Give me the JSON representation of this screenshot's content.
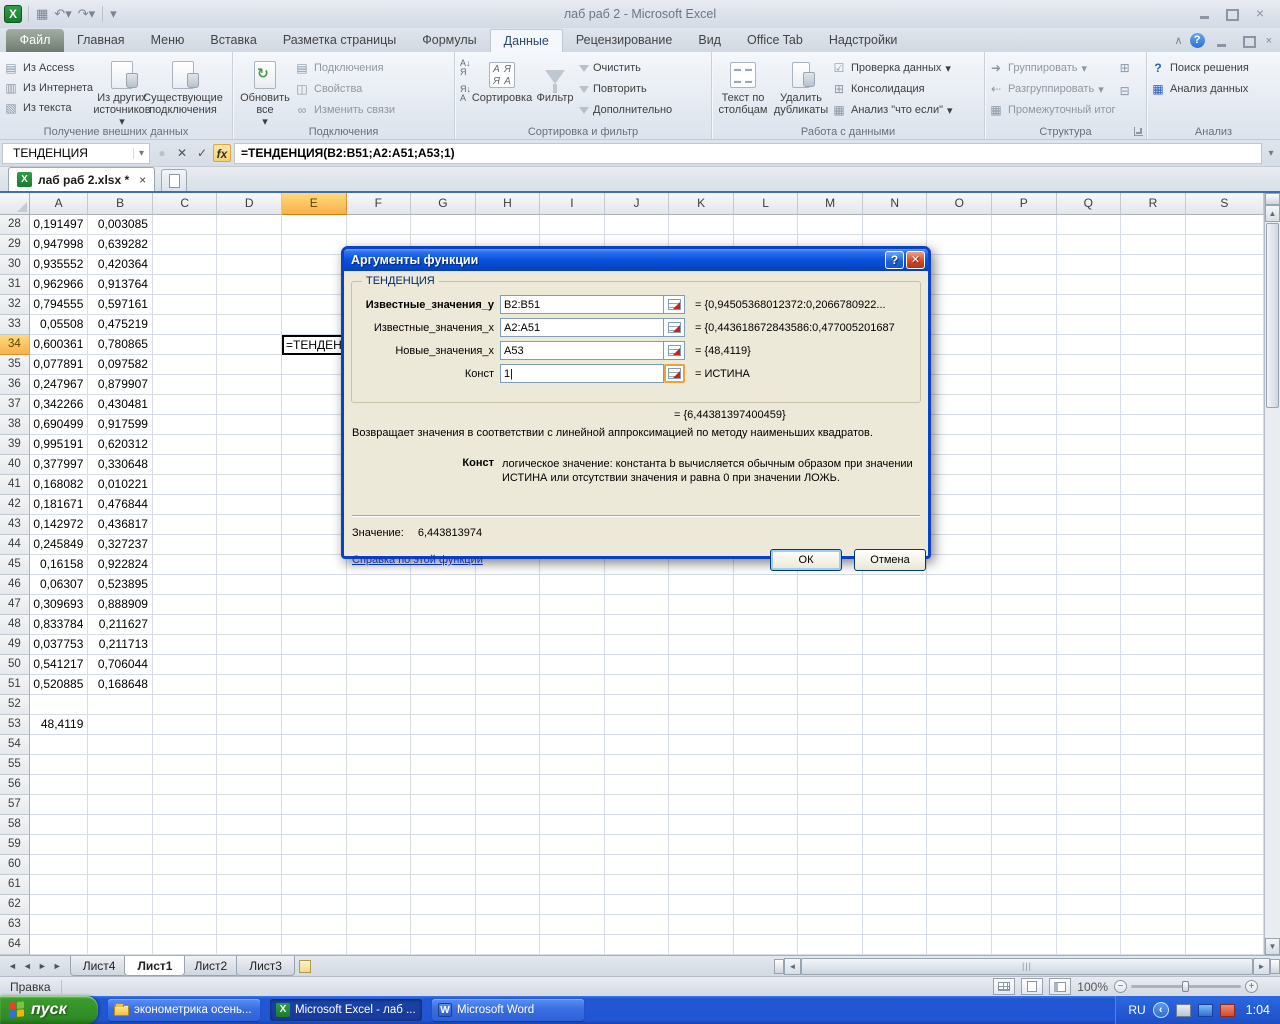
{
  "window": {
    "title": "лаб раб 2  -  Microsoft Excel"
  },
  "ribbon": {
    "file_tab": "Файл",
    "tabs": [
      {
        "label": "Главная",
        "active": false
      },
      {
        "label": "Меню",
        "active": false
      },
      {
        "label": "Вставка",
        "active": false
      },
      {
        "label": "Разметка страницы",
        "active": false
      },
      {
        "label": "Формулы",
        "active": false
      },
      {
        "label": "Данные",
        "active": true
      },
      {
        "label": "Рецензирование",
        "active": false
      },
      {
        "label": "Вид",
        "active": false
      },
      {
        "label": "Office Tab",
        "active": false
      },
      {
        "label": "Надстройки",
        "active": false
      }
    ],
    "groups": [
      {
        "label": "Получение внешних данных",
        "items": [
          "Из Access",
          "Из Интернета",
          "Из текста",
          "Из других источников",
          "Существующие подключения"
        ]
      },
      {
        "label": "Подключения",
        "items": [
          "Обновить все",
          "Подключения",
          "Свойства",
          "Изменить связи"
        ]
      },
      {
        "label": "Сортировка и фильтр",
        "items": [
          "Сортировка",
          "Фильтр",
          "Очистить",
          "Повторить",
          "Дополнительно"
        ]
      },
      {
        "label": "Работа с данными",
        "items": [
          "Текст по столбцам",
          "Удалить дубликаты",
          "Проверка данных",
          "Консолидация",
          "Анализ \"что если\""
        ]
      },
      {
        "label": "Структура",
        "items": [
          "Группировать",
          "Разгруппировать",
          "Промежуточный итог"
        ]
      },
      {
        "label": "Анализ",
        "items": [
          "Поиск решения",
          "Анализ данных"
        ]
      }
    ]
  },
  "formula_bar": {
    "name_box": "ТЕНДЕНЦИЯ",
    "fx_label": "fx",
    "formula": "=ТЕНДЕНЦИЯ(B2:B51;A2:A51;A53;1)"
  },
  "doc_tabs": {
    "active_tab": "лаб раб 2.xlsx *"
  },
  "grid": {
    "columns": [
      "A",
      "B",
      "C",
      "D",
      "E",
      "F",
      "G",
      "H",
      "I",
      "J",
      "K",
      "L",
      "M",
      "N",
      "O",
      "P",
      "Q",
      "R",
      "S"
    ],
    "selected_column": "E",
    "selected_row": 34,
    "first_row": 28,
    "last_row": 64,
    "editing": {
      "cell": "E34",
      "text": "=ТЕНДЕН"
    },
    "rows": [
      {
        "n": 28,
        "a": "0,191497",
        "b": "0,003085"
      },
      {
        "n": 29,
        "a": "0,947998",
        "b": "0,639282"
      },
      {
        "n": 30,
        "a": "0,935552",
        "b": "0,420364"
      },
      {
        "n": 31,
        "a": "0,962966",
        "b": "0,913764"
      },
      {
        "n": 32,
        "a": "0,794555",
        "b": "0,597161"
      },
      {
        "n": 33,
        "a": "0,05508",
        "b": "0,475219"
      },
      {
        "n": 34,
        "a": "0,600361",
        "b": "0,780865"
      },
      {
        "n": 35,
        "a": "0,077891",
        "b": "0,097582"
      },
      {
        "n": 36,
        "a": "0,247967",
        "b": "0,879907"
      },
      {
        "n": 37,
        "a": "0,342266",
        "b": "0,430481"
      },
      {
        "n": 38,
        "a": "0,690499",
        "b": "0,917599"
      },
      {
        "n": 39,
        "a": "0,995191",
        "b": "0,620312"
      },
      {
        "n": 40,
        "a": "0,377997",
        "b": "0,330648"
      },
      {
        "n": 41,
        "a": "0,168082",
        "b": "0,010221"
      },
      {
        "n": 42,
        "a": "0,181671",
        "b": "0,476844"
      },
      {
        "n": 43,
        "a": "0,142972",
        "b": "0,436817"
      },
      {
        "n": 44,
        "a": "0,245849",
        "b": "0,327237"
      },
      {
        "n": 45,
        "a": "0,16158",
        "b": "0,922824"
      },
      {
        "n": 46,
        "a": "0,06307",
        "b": "0,523895"
      },
      {
        "n": 47,
        "a": "0,309693",
        "b": "0,888909"
      },
      {
        "n": 48,
        "a": "0,833784",
        "b": "0,211627"
      },
      {
        "n": 49,
        "a": "0,037753",
        "b": "0,211713"
      },
      {
        "n": 50,
        "a": "0,541217",
        "b": "0,706044"
      },
      {
        "n": 51,
        "a": "0,520885",
        "b": "0,168648"
      },
      {
        "n": 53,
        "a": "48,4119",
        "b": ""
      }
    ]
  },
  "dialog": {
    "title": "Аргументы функции",
    "function_name": "ТЕНДЕНЦИЯ",
    "fields": [
      {
        "label": "Известные_значения_y",
        "value": "B2:B51",
        "result": "=  {0,94505368012372:0,2066780922..."
      },
      {
        "label": "Известные_значения_x",
        "value": "A2:A51",
        "result": "=  {0,443618672843586:0,477005201687"
      },
      {
        "label": "Новые_значения_x",
        "value": "A53",
        "result": "=  {48,4119}"
      },
      {
        "label": "Конст",
        "value": "1|",
        "result": "=  ИСТИНА"
      }
    ],
    "formula_result": "=  {6,44381397400459}",
    "description": "Возвращает значения в соответствии с линейной аппроксимацией по методу наименьших квадратов.",
    "arg_help_label": "Конст",
    "arg_help_text": "логическое значение: константа b вычисляется обычным образом при значении ИСТИНА или отсутствии значения и равна 0 при значении ЛОЖЬ.",
    "value_label": "Значение:",
    "value": "6,443813974",
    "help_link": "Справка по этой функции",
    "ok_label": "ОК",
    "cancel_label": "Отмена"
  },
  "sheet_tabs": {
    "tabs": [
      "Лист4",
      "Лист1",
      "Лист2",
      "Лист3"
    ],
    "active": "Лист1"
  },
  "status_bar": {
    "mode": "Правка",
    "zoom": "100%"
  },
  "taskbar": {
    "start_label": "пуск",
    "buttons": [
      {
        "label": "эконометрика осень...",
        "icon": "folder",
        "active": false
      },
      {
        "label": "Microsoft Excel - лаб ...",
        "icon": "excel",
        "active": true
      },
      {
        "label": "Microsoft Word",
        "icon": "word",
        "active": false
      }
    ],
    "tray": {
      "lang": "RU",
      "time": "1:04"
    }
  },
  "icons": {
    "dropdown": "▾",
    "cancel": "✕",
    "enter": "✓",
    "dim_dot": "●",
    "undo": "↶",
    "redo": "↷",
    "refresh": "↻",
    "up": "▲",
    "down": "▼",
    "left": "◄",
    "right": "►",
    "sort_a": "А",
    "sort_z": "Я",
    "arrow_dn": "↓",
    "group_r": "⇥",
    "group_l": "⇤",
    "plus_box": "⊞",
    "minus_box": "⊟",
    "question": "?",
    "collapse": "∧",
    "x_small": "×",
    "chev_left": "‹",
    "grip": "|||",
    "letters": "АЯЯА"
  }
}
